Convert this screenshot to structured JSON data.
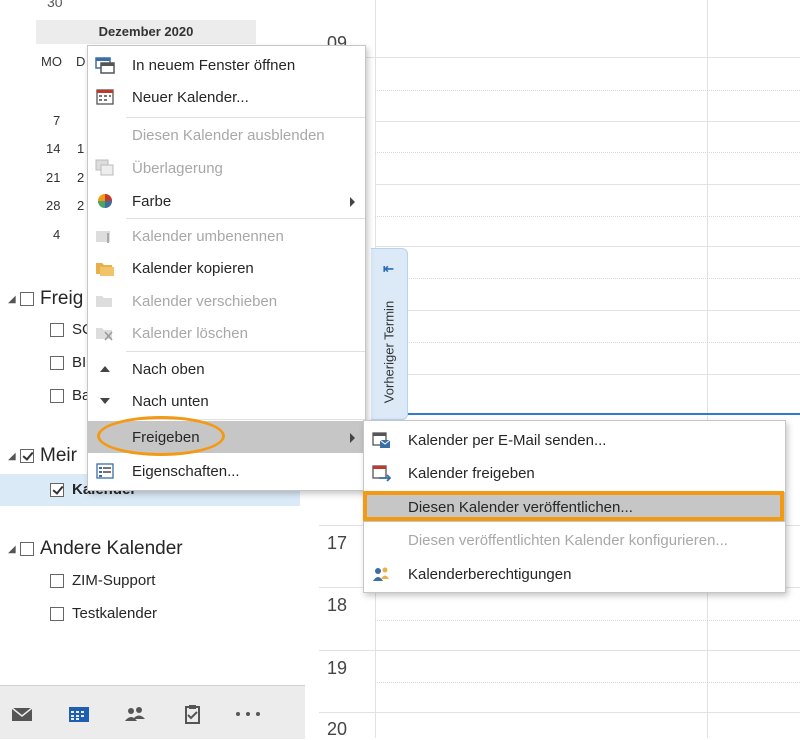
{
  "mini_calendar": {
    "prev_day": "30",
    "month_label": "Dezember 2020",
    "weekday_mo": "MO",
    "weekday_di": "D",
    "week_days": [
      "7",
      "14",
      "21",
      "28",
      "4"
    ],
    "week_days2": [
      "1",
      "2",
      "2"
    ]
  },
  "folders": {
    "group_freigegeben": "Freig",
    "shared_items": [
      "SC",
      "BI",
      "Ba"
    ],
    "group_meine": "Meir",
    "my_item": "Kalender",
    "group_andere": "Andere Kalender",
    "other_items": [
      "ZIM-Support",
      "Testkalender"
    ]
  },
  "grid": {
    "hours": [
      "09",
      "17",
      "18",
      "19",
      "20"
    ],
    "prev_appointment": "Vorheriger Termin"
  },
  "context_menu": {
    "items": [
      {
        "label": "In neuem Fenster öffnen",
        "icon": "new-window-icon"
      },
      {
        "label": "Neuer Kalender...",
        "icon": "new-calendar-icon"
      },
      {
        "label": "Diesen Kalender ausblenden",
        "icon": ""
      },
      {
        "label": "Überlagerung",
        "icon": "overlay-icon"
      },
      {
        "label": "Farbe",
        "icon": "color-icon"
      },
      {
        "label": "Kalender umbenennen",
        "icon": "rename-icon"
      },
      {
        "label": "Kalender kopieren",
        "icon": "copy-folder-icon"
      },
      {
        "label": "Kalender verschieben",
        "icon": "move-folder-icon"
      },
      {
        "label": "Kalender löschen",
        "icon": "delete-folder-icon"
      },
      {
        "label": "Nach oben",
        "icon": "up-arrow-icon"
      },
      {
        "label": "Nach unten",
        "icon": "down-arrow-icon"
      },
      {
        "label": "Freigeben",
        "icon": ""
      },
      {
        "label": "Eigenschaften...",
        "icon": "properties-icon"
      }
    ]
  },
  "submenu": {
    "items": [
      {
        "label": "Kalender per E-Mail senden...",
        "icon": "email-calendar-icon"
      },
      {
        "label": "Kalender freigeben",
        "icon": "share-calendar-icon"
      },
      {
        "label": "Diesen Kalender veröffentlichen...",
        "icon": ""
      },
      {
        "label": "Diesen veröffentlichten Kalender konfigurieren...",
        "icon": ""
      },
      {
        "label": "Kalenderberechtigungen",
        "icon": "permissions-icon"
      }
    ]
  },
  "colors": {
    "accent": "#2f7bd2",
    "highlight_orange": "#f39a12",
    "menu_highlight": "#c6c6c6"
  }
}
